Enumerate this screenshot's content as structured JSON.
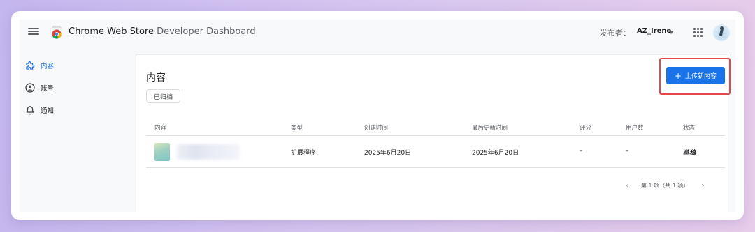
{
  "header": {
    "title_main": "Chrome Web Store",
    "title_sub": " Developer Dashboard",
    "publisher_label": "发布者：",
    "publisher_name": "AZ_Irene"
  },
  "sidebar": {
    "items": [
      {
        "label": "内容",
        "icon": "puzzle-icon",
        "active": true
      },
      {
        "label": "账号",
        "icon": "account-circle-icon",
        "active": false
      },
      {
        "label": "通知",
        "icon": "bell-icon",
        "active": false
      }
    ]
  },
  "main": {
    "page_title": "内容",
    "archived_label": "已归档",
    "upload_label": "上传新内容",
    "upload_icon": "+",
    "table": {
      "headers": [
        "内容",
        "类型",
        "创建时间",
        "最后更新时间",
        "评分",
        "用户数",
        "状态"
      ],
      "rows": [
        {
          "type": "扩展程序",
          "created": "2025年6月20日",
          "updated": "2025年6月20日",
          "rating": "–",
          "users": "–",
          "status": "草稿"
        }
      ]
    },
    "pagination": {
      "text": "第 1 项（共 1 项）",
      "prev": "‹",
      "next": "›"
    }
  },
  "colors": {
    "accent": "#1a73e8",
    "highlight": "#e8474a"
  }
}
